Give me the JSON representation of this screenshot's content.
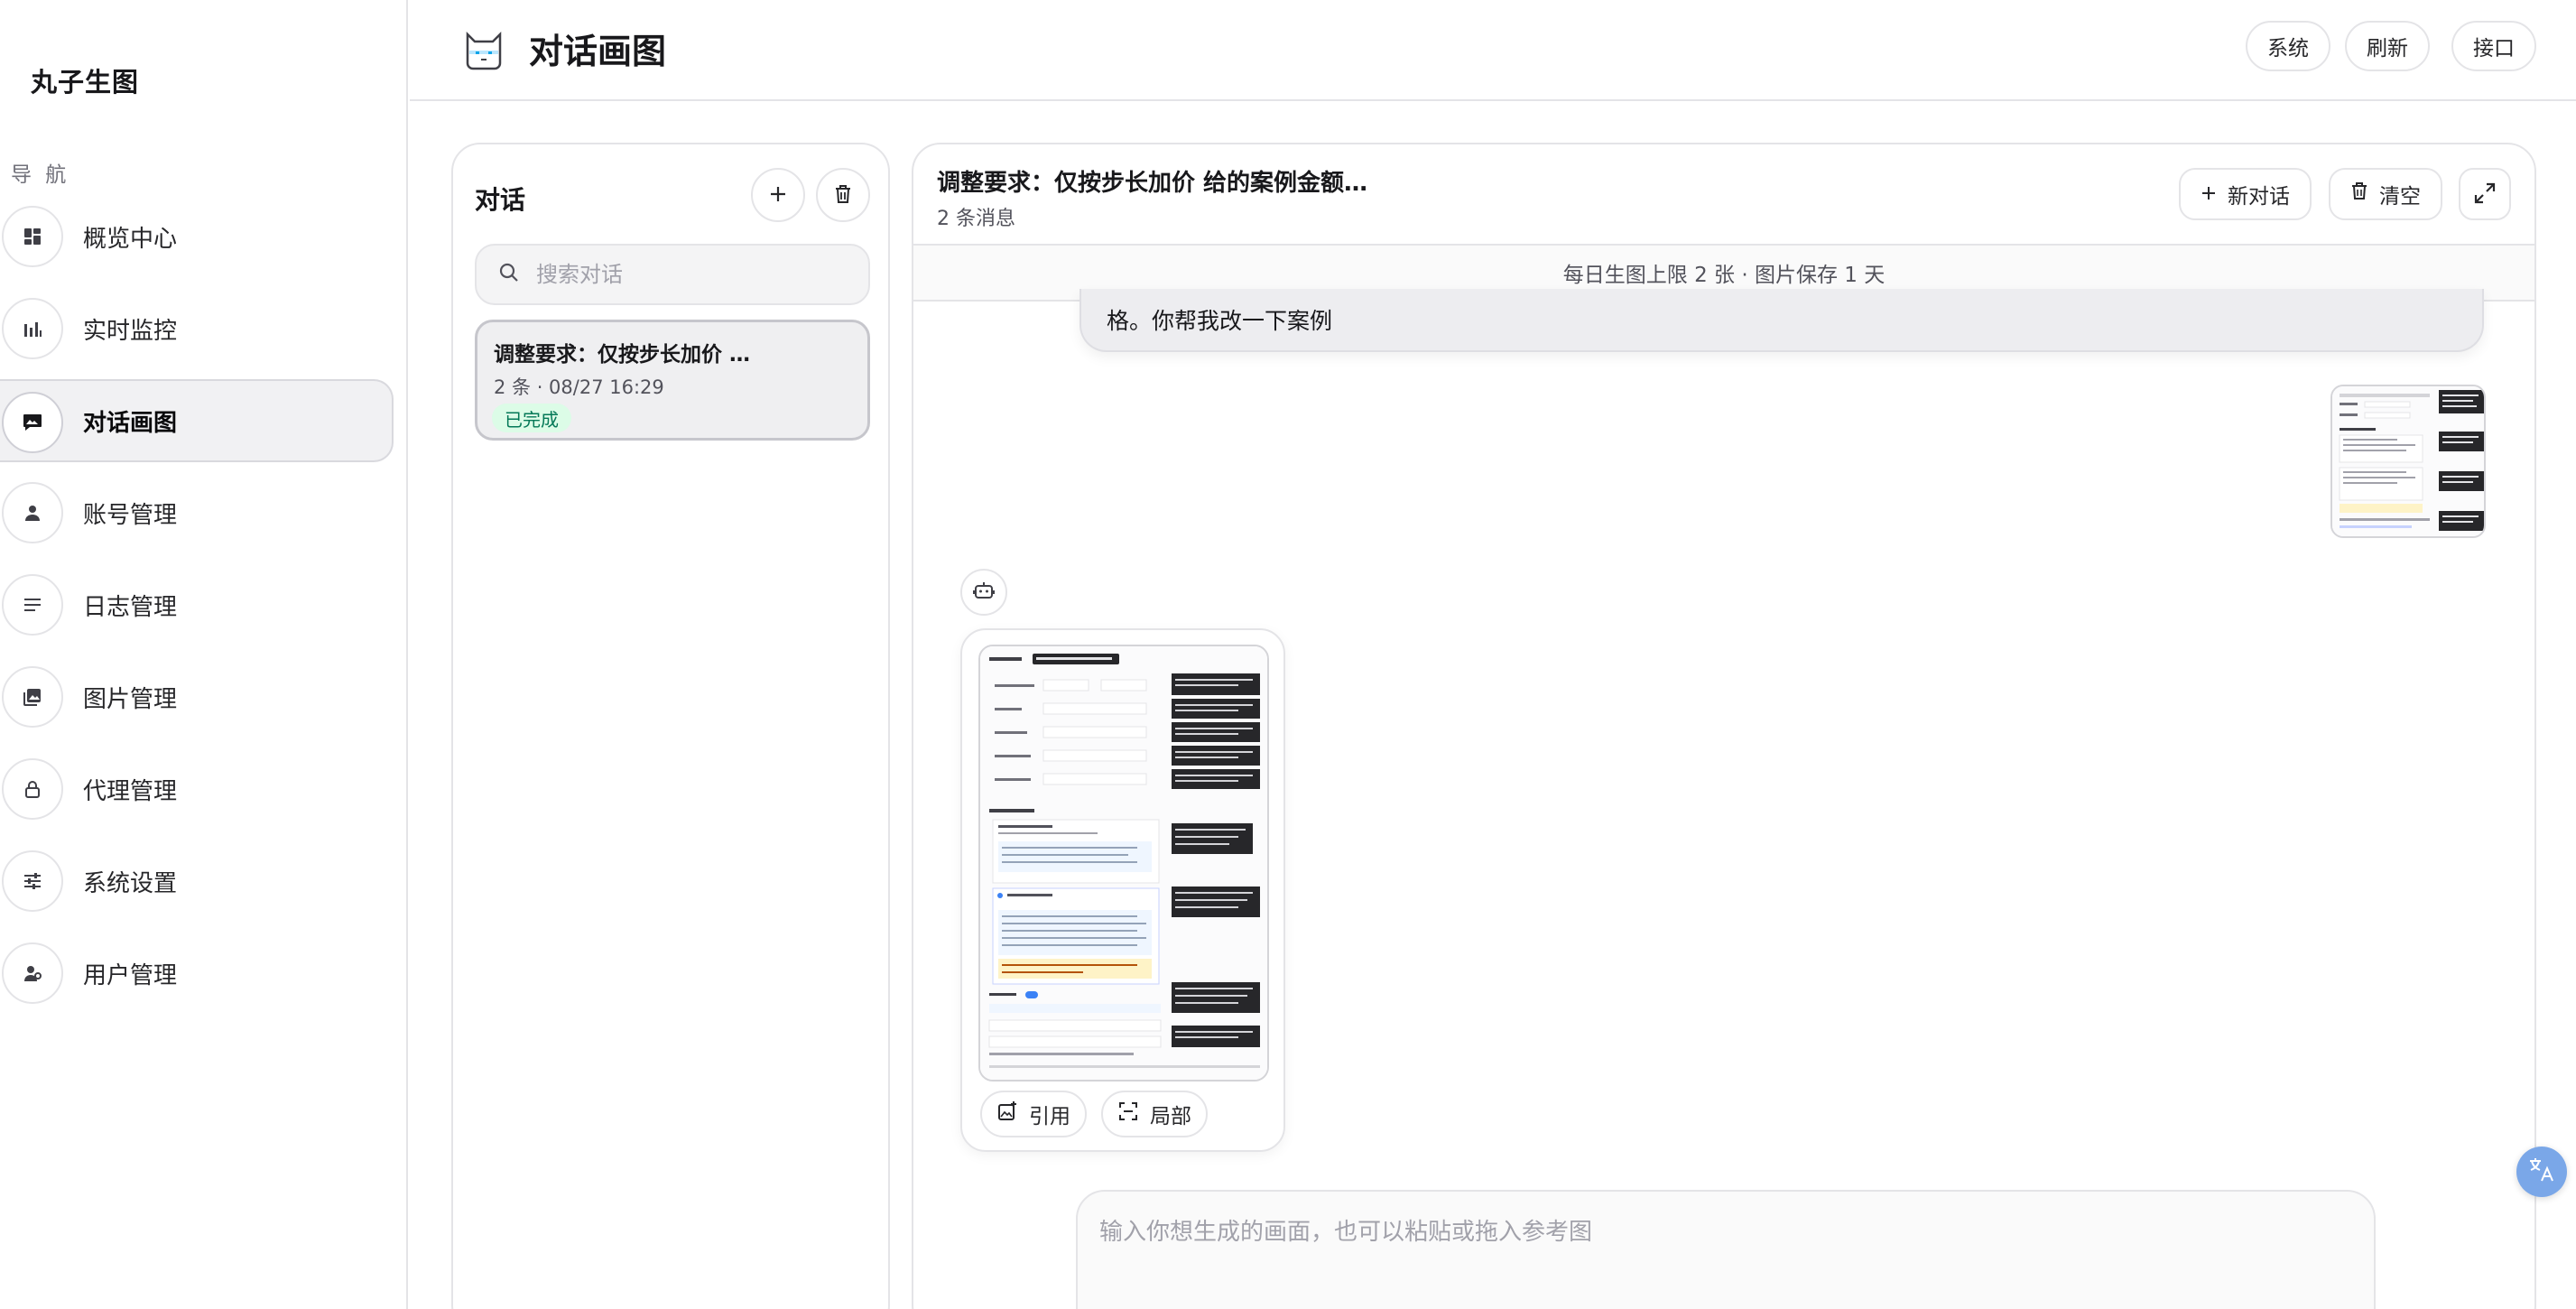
{
  "app": {
    "brand": "丸子生图"
  },
  "sidebar": {
    "heading": "导 航",
    "items": [
      {
        "label": "概览中心",
        "icon": "dashboard-icon"
      },
      {
        "label": "实时监控",
        "icon": "bar-chart-icon"
      },
      {
        "label": "对话画图",
        "icon": "chat-image-icon",
        "active": true
      },
      {
        "label": "账号管理",
        "icon": "person-icon"
      },
      {
        "label": "日志管理",
        "icon": "list-icon"
      },
      {
        "label": "图片管理",
        "icon": "image-gallery-icon"
      },
      {
        "label": "代理管理",
        "icon": "lock-icon"
      },
      {
        "label": "系统设置",
        "icon": "sliders-icon"
      },
      {
        "label": "用户管理",
        "icon": "user-manage-icon"
      }
    ]
  },
  "topbar": {
    "title": "对话画图",
    "buttons": {
      "system": "系统",
      "refresh": "刷新",
      "api": "接口"
    }
  },
  "conversations": {
    "title": "对话",
    "search_placeholder": "搜索对话",
    "items": [
      {
        "title": "调整要求：仅按步长加价 …",
        "meta": "2 条  ·  08/27 16:29",
        "status": "已完成"
      }
    ]
  },
  "chat": {
    "title": "调整要求：仅按步长加价 给的案例金额…",
    "subtitle": "2 条消息",
    "new_label": "新对话",
    "clear_label": "清空",
    "notice": "每日生图上限 2 张 · 图片保存 1 天",
    "user_message": "格。你帮我改一下案例",
    "card_buttons": {
      "quote": "引用",
      "partial": "局部"
    },
    "composer_placeholder": "输入你想生成的画面，也可以粘贴或拖入参考图"
  },
  "colors": {
    "accent_green_bg": "#dcfce7",
    "accent_green_text": "#047857",
    "active_nav_bg": "#f1f1f3",
    "translate_fab": "#7aa7e8"
  }
}
